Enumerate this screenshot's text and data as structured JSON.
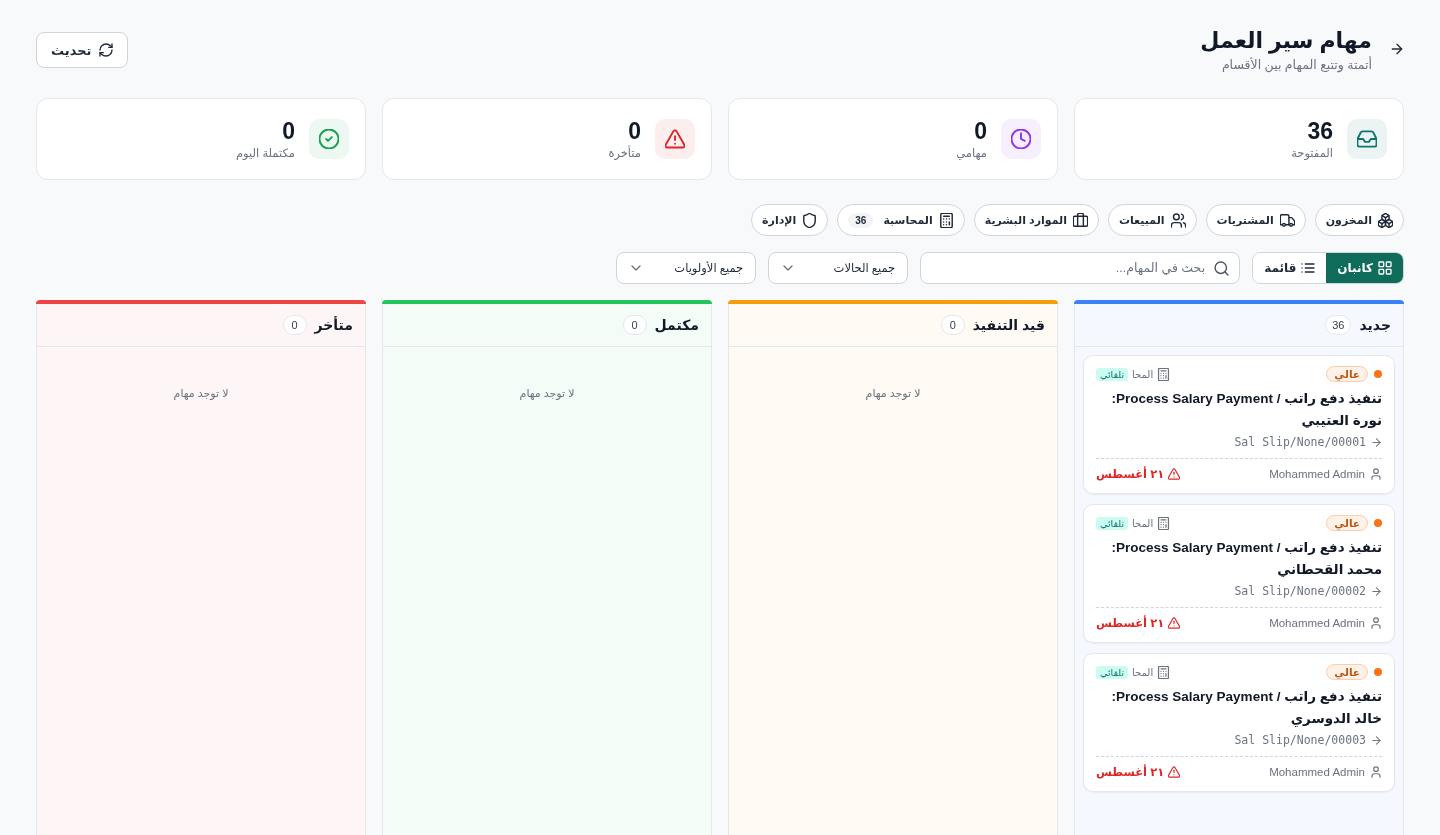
{
  "header": {
    "title": "مهام سير العمل",
    "subtitle": "أتمتة وتتبع المهام بين الأقسام",
    "refresh_button": "تحديث"
  },
  "stats": [
    {
      "kind": "inbox",
      "value": "36",
      "label": "المفتوحة"
    },
    {
      "kind": "clock",
      "value": "0",
      "label": "مهامي"
    },
    {
      "kind": "alert",
      "value": "0",
      "label": "متأخرة"
    },
    {
      "kind": "check",
      "value": "0",
      "label": "مكتملة اليوم"
    }
  ],
  "departments": [
    {
      "kind": "boxes",
      "label": "المخزون"
    },
    {
      "kind": "truck",
      "label": "المشتريات"
    },
    {
      "kind": "users",
      "label": "المبيعات"
    },
    {
      "kind": "briefcase",
      "label": "الموارد البشرية"
    },
    {
      "kind": "calculator",
      "label": "المحاسبة",
      "count": "36"
    },
    {
      "kind": "shield",
      "label": "الإدارة"
    }
  ],
  "toolbar": {
    "views": [
      {
        "kind": "grid",
        "label": "كانبان",
        "selected": true
      },
      {
        "kind": "list",
        "label": "قائمة",
        "selected": false
      }
    ],
    "search": {
      "placeholder": "بحث في المهام..."
    },
    "filters": [
      {
        "value": "جميع الحالات"
      },
      {
        "value": "جميع الأولويات"
      }
    ]
  },
  "columns": [
    {
      "title": "جديد",
      "count": "36",
      "color": "#3b82f6",
      "tasks": [
        {
          "priority": {
            "label": "عالي",
            "color": "#f97316"
          },
          "department": "المحا",
          "auto_badge": "تلقائي",
          "title": "تنفيذ دفع راتب / Process Salary Payment: نورة العتيبي",
          "reference": "Sal Slip/None/00001",
          "assignee": "Mohammed Admin",
          "due": "٢١ أغسطس",
          "overdue": true
        },
        {
          "priority": {
            "label": "عالي",
            "color": "#f97316"
          },
          "department": "المحا",
          "auto_badge": "تلقائي",
          "title": "تنفيذ دفع راتب / Process Salary Payment: محمد القحطاني",
          "reference": "Sal Slip/None/00002",
          "assignee": "Mohammed Admin",
          "due": "٢١ أغسطس",
          "overdue": true
        },
        {
          "priority": {
            "label": "عالي",
            "color": "#f97316"
          },
          "department": "المحا",
          "auto_badge": "تلقائي",
          "title": "تنفيذ دفع راتب / Process Salary Payment: خالد الدوسري",
          "reference": "Sal Slip/None/00003",
          "assignee": "Mohammed Admin",
          "due": "٢١ أغسطس",
          "overdue": true
        }
      ]
    },
    {
      "title": "قيد التنفيذ",
      "count": "0",
      "color": "#f59e0b",
      "empty_text": "لا توجد مهام"
    },
    {
      "title": "مكتمل",
      "count": "0",
      "color": "#22c55e",
      "empty_text": "لا توجد مهام"
    },
    {
      "title": "متأخر",
      "count": "0",
      "color": "#ef4444",
      "empty_text": "لا توجد مهام"
    }
  ]
}
